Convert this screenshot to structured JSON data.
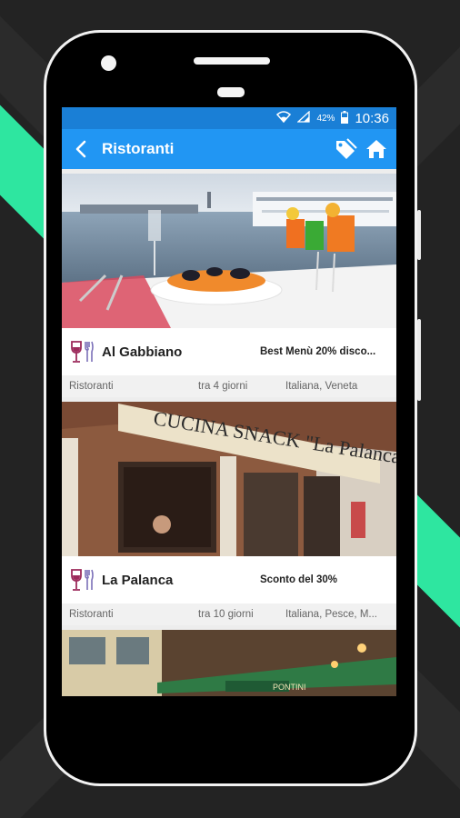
{
  "status": {
    "percent": "42%",
    "time": "10:36"
  },
  "toolbar": {
    "title": "Ristoranti",
    "back_icon": "back-arrow-icon",
    "tag_icon": "tag-icon",
    "home_icon": "home-icon"
  },
  "colors": {
    "toolbar": "#2196f3",
    "statusbar": "#1a7fd6",
    "accent": "#2ee6a0"
  },
  "cards": [
    {
      "name": "Al Gabbiano",
      "promo": "Best Menù 20% disco...",
      "category": "Ristoranti",
      "when": "tra 4 giorni",
      "cuisine": "Italiana, Veneta",
      "icon": "wine-glass-cutlery-icon"
    },
    {
      "name": "La Palanca",
      "promo": "Sconto del 30%",
      "category": "Ristoranti",
      "when": "tra 10 giorni",
      "cuisine": "Italiana, Pesce, M...",
      "icon": "wine-glass-cutlery-icon",
      "sign_text": "CUCINA SNACK \"La Palanca\""
    },
    {
      "sign_text": "PONTINI"
    }
  ]
}
